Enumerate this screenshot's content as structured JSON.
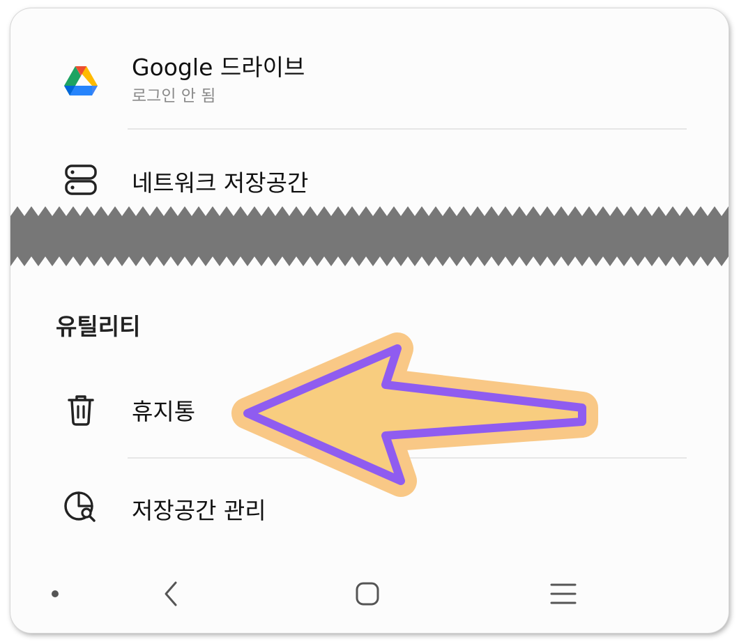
{
  "storage": {
    "items": [
      {
        "icon": "google-drive-icon",
        "title": "Google 드라이브",
        "subtitle": "로그인 안 됨"
      },
      {
        "icon": "network-storage-icon",
        "title": "네트워크 저장공간"
      }
    ]
  },
  "utilities": {
    "header": "유틸리티",
    "items": [
      {
        "icon": "trash-icon",
        "title": "휴지통"
      },
      {
        "icon": "storage-analysis-icon",
        "title": "저장공간 관리"
      }
    ]
  },
  "navbar": {
    "buttons": [
      "dot-indicator",
      "back-icon",
      "home-icon",
      "recents-icon"
    ]
  },
  "annotation": {
    "arrow_fill": "#f8cd7f",
    "arrow_outline": "#8f5cf0",
    "arrow_halo": "#f9c886",
    "points_to": "휴지통"
  },
  "colors": {
    "drive_green": "#1ea362",
    "drive_yellow": "#ffba00",
    "drive_blue": "#4285f4",
    "drive_red": "#ea4335",
    "drive_dark_blue": "#2684fc",
    "tear_band": "#777777"
  }
}
